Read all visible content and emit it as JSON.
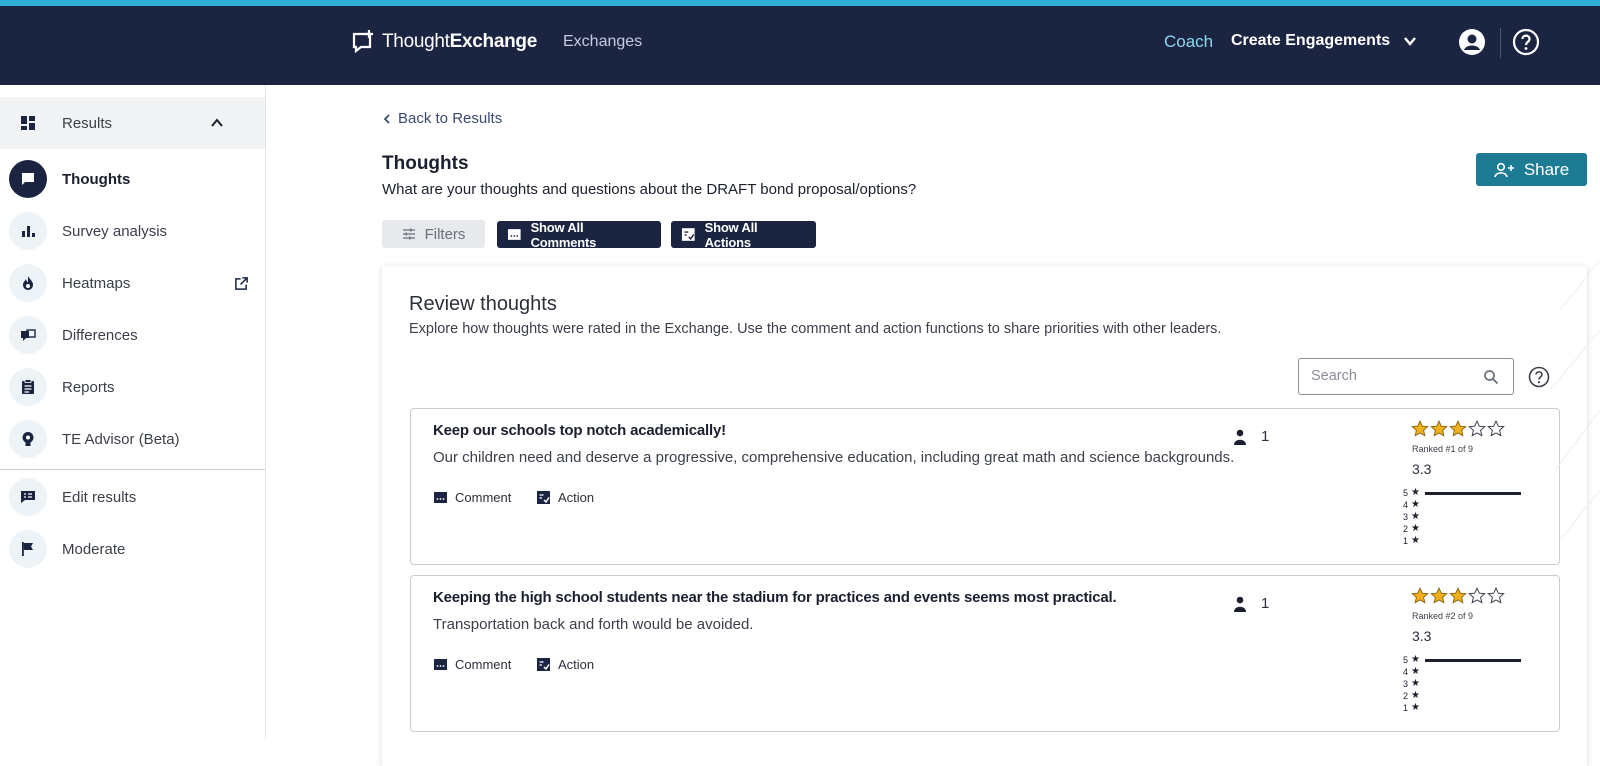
{
  "brand": {
    "name_light": "Thought",
    "name_bold": "Exchange"
  },
  "topnav": {
    "exchanges": "Exchanges",
    "coach": "Coach",
    "create": "Create Engagements"
  },
  "sidebar": {
    "results": "Results",
    "items": [
      {
        "label": "Thoughts",
        "icon": "chat-bubble-icon"
      },
      {
        "label": "Survey analysis",
        "icon": "bar-chart-icon"
      },
      {
        "label": "Heatmaps",
        "icon": "flame-icon"
      },
      {
        "label": "Differences",
        "icon": "compare-icon"
      },
      {
        "label": "Reports",
        "icon": "clipboard-icon"
      },
      {
        "label": "TE Advisor (Beta)",
        "icon": "advisor-icon"
      },
      {
        "label": "Edit results",
        "icon": "edit-results-icon"
      },
      {
        "label": "Moderate",
        "icon": "flag-icon"
      }
    ]
  },
  "page": {
    "back": "Back to Results",
    "title": "Thoughts",
    "question": "What are your thoughts and questions about the DRAFT bond proposal/options?",
    "share": "Share",
    "filters": "Filters",
    "show_comments": "Show All Comments",
    "show_actions": "Show All Actions"
  },
  "review": {
    "title": "Review thoughts",
    "description": "Explore how thoughts were rated in the Exchange. Use the comment and action functions to share priorities with other leaders.",
    "search_placeholder": "Search",
    "comment_label": "Comment",
    "action_label": "Action",
    "thoughts": [
      {
        "title": "Keep our schools top notch academically!",
        "body": "Our children need and deserve a progressive, comprehensive education, including great math and science backgrounds.",
        "participants": "1",
        "stars_filled": 3,
        "rank": "Ranked #1 of 9",
        "score": "3.3",
        "distribution": [
          1,
          0,
          0,
          0,
          0
        ]
      },
      {
        "title": "Keeping the high school students near the stadium for practices and events seems most practical.",
        "body": "Transportation back and forth would be avoided.",
        "participants": "1",
        "stars_filled": 3,
        "rank": "Ranked #2 of 9",
        "score": "3.3",
        "distribution": [
          1,
          0,
          0,
          0,
          0
        ]
      }
    ]
  },
  "colors": {
    "navy": "#1b2542",
    "accent": "#2fb0d6",
    "teal": "#1d7b94",
    "star": "#f2b01e"
  }
}
